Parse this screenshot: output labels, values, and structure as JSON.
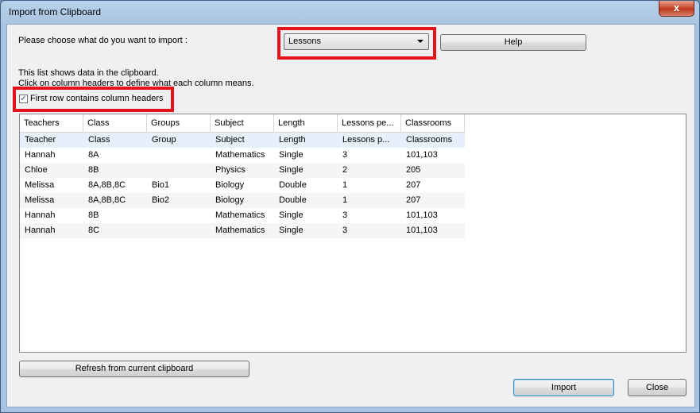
{
  "window": {
    "title": "Import from Clipboard",
    "close_glyph": "x"
  },
  "prompt": "Please choose what do you want to import :",
  "import_type": {
    "selected": "Lessons"
  },
  "help_label": "Help",
  "info_line1": "This list shows data in the clipboard.",
  "info_line2": "Click on column headers to define what each column means.",
  "first_row_headers": {
    "label": "First row contains column headers",
    "checked": true
  },
  "table": {
    "columns": [
      "Teachers",
      "Class",
      "Groups",
      "Subject",
      "Length",
      "Lessons pe...",
      "Classrooms"
    ],
    "rows": [
      [
        "Teacher",
        "Class",
        "Group",
        "Subject",
        "Length",
        "Lessons p...",
        "Classrooms"
      ],
      [
        "Hannah",
        "8A",
        "",
        "Mathematics",
        "Single",
        "3",
        "101,103"
      ],
      [
        "Chloe",
        "8B",
        "",
        "Physics",
        "Single",
        "2",
        "205"
      ],
      [
        "Melissa",
        "8A,8B,8C",
        "Bio1",
        "Biology",
        "Double",
        "1",
        "207"
      ],
      [
        "Melissa",
        "8A,8B,8C",
        "Bio2",
        "Biology",
        "Double",
        "1",
        "207"
      ],
      [
        "Hannah",
        "8B",
        "",
        "Mathematics",
        "Single",
        "3",
        "101,103"
      ],
      [
        "Hannah",
        "8C",
        "",
        "Mathematics",
        "Single",
        "3",
        "101,103"
      ]
    ]
  },
  "refresh_label": "Refresh from current clipboard",
  "import_label": "Import",
  "close_label": "Close"
}
